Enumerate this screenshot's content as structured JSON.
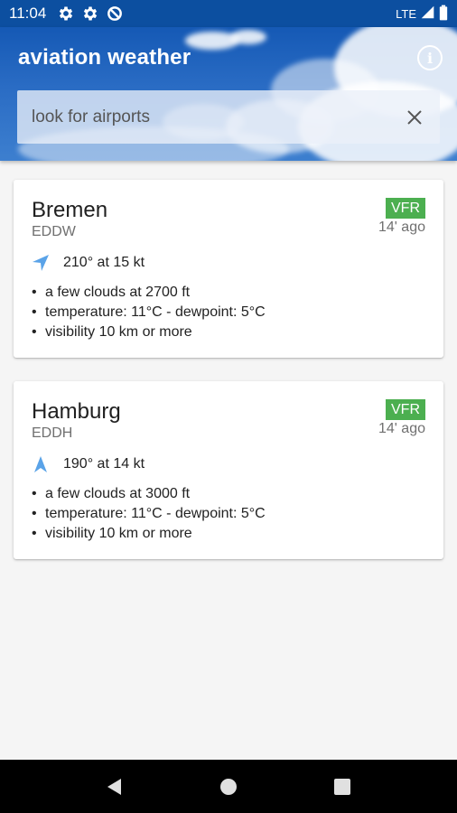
{
  "status_bar": {
    "time": "11:04",
    "network": "LTE",
    "icons": [
      "gear-icon",
      "gear-icon",
      "data-saver-icon",
      "signal-icon",
      "battery-icon"
    ]
  },
  "header": {
    "title": "aviation weather",
    "search": {
      "placeholder": "look for airports",
      "value": ""
    },
    "icons": [
      "info-icon",
      "close-icon"
    ]
  },
  "stations": [
    {
      "city": "Bremen",
      "icao": "EDDW",
      "category": "VFR",
      "age": "14' ago",
      "wind": "210° at 15 kt",
      "details": [
        "a few clouds at 2700 ft",
        "temperature: 11°C - dewpoint: 5°C",
        "visibility 10 km or more"
      ]
    },
    {
      "city": "Hamburg",
      "icao": "EDDH",
      "category": "VFR",
      "age": "14' ago",
      "wind": "190° at 14 kt",
      "details": [
        "a few clouds at 3000 ft",
        "temperature: 11°C - dewpoint: 5°C",
        "visibility 10 km or more"
      ]
    }
  ],
  "colors": {
    "header_blue": "#1559b5",
    "vfr_green": "#4caf50",
    "wind_arrow": "#5aa3e8"
  },
  "nav_bar": {
    "icons": [
      "back-icon",
      "home-icon",
      "recents-icon"
    ]
  }
}
